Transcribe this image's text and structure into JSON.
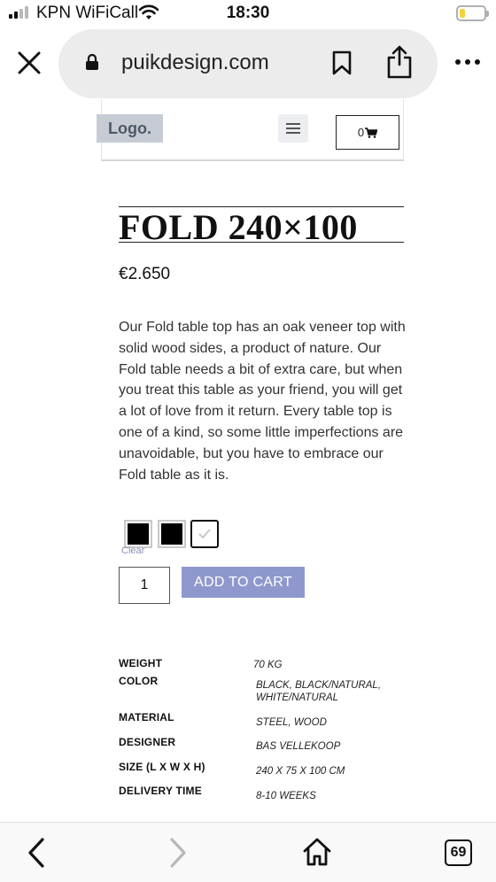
{
  "status_bar": {
    "carrier": "KPN WiFiCall",
    "time": "18:30"
  },
  "browser": {
    "url": "puikdesign.com"
  },
  "site_header": {
    "logo_text": "Logo.",
    "cart_count": "0"
  },
  "product": {
    "title": "FOLD 240×100",
    "price": "€2.650",
    "description": "Our Fold table top has an oak veneer top with solid wood sides, a product of nature. Our Fold table needs a bit of extra care, but when you treat this table as your friend, you will get a lot of love from it return.  Every table top is one of a kind, so some little imperfections are unavoidable, but you have to embrace our Fold table as it is.",
    "swatches": [
      {
        "name": "black",
        "color": "#000000"
      },
      {
        "name": "black-natural",
        "color": "#000000"
      },
      {
        "name": "white-natural",
        "color": "#ffffff",
        "selected": true
      }
    ],
    "clear_label": "Clear",
    "quantity": "1",
    "add_to_cart_label": "ADD TO CART"
  },
  "specs": [
    {
      "label": "WEIGHT",
      "value": "70 KG"
    },
    {
      "label": "COLOR",
      "value": "BLACK, BLACK/NATURAL, WHITE/NATURAL"
    },
    {
      "label": "MATERIAL",
      "value": "STEEL, WOOD"
    },
    {
      "label": "DESIGNER",
      "value": "BAS VELLEKOOP"
    },
    {
      "label": "SIZE (L X W X H)",
      "value": "240 X 75 X 100 CM"
    },
    {
      "label": "DELIVERY TIME",
      "value": "8-10 WEEKS"
    }
  ],
  "bottom_bar": {
    "tab_count": "69"
  },
  "colors": {
    "button_accent": "#8f98cd",
    "logo_bg": "#c7ccd4",
    "battery": "#f3d33a"
  },
  "icons": [
    "signal-icon",
    "wifi-icon",
    "battery-icon",
    "close-icon",
    "lock-icon",
    "bookmark-icon",
    "share-icon",
    "more-icon",
    "hamburger-icon",
    "cart-icon",
    "checkmark-icon",
    "back-icon",
    "forward-icon",
    "home-icon",
    "tabs-icon"
  ]
}
